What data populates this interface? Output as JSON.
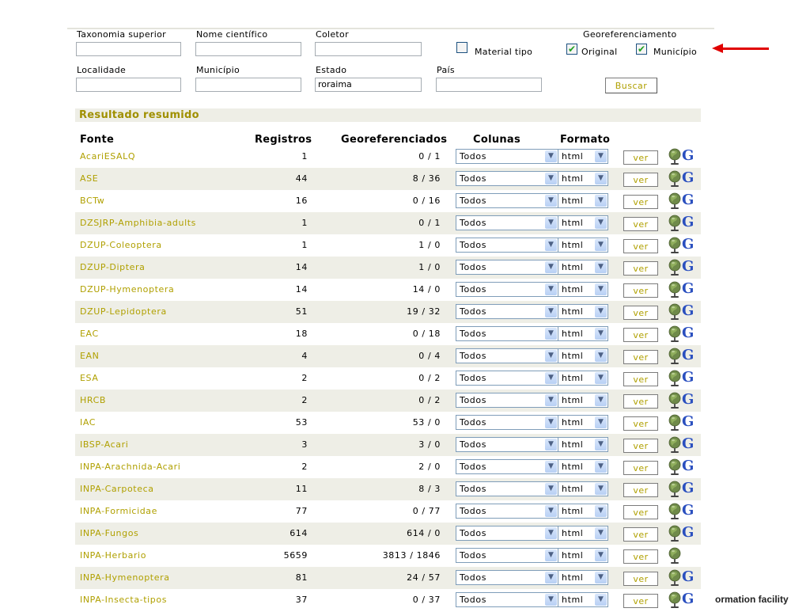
{
  "search_form": {
    "taxonomia_label": "Taxonomia superior",
    "nome_label": "Nome científico",
    "coletor_label": "Coletor",
    "material_tipo_label": "Material tipo",
    "georef_label": "Georeferenciamento",
    "original_label": "Original",
    "municipio_cb_label": "Município",
    "localidade_label": "Localidade",
    "municipio_label": "Município",
    "estado_label": "Estado",
    "estado_value": "roraima",
    "pais_label": "País",
    "buscar_label": "Buscar",
    "material_tipo_checked": false,
    "original_checked": true,
    "municipio_checked": true
  },
  "results": {
    "title": "Resultado resumido",
    "headers": {
      "fonte": "Fonte",
      "registros": "Registros",
      "georef": "Georeferenciados",
      "colunas": "Colunas",
      "formato": "Formato"
    },
    "ver_label": "ver",
    "g_label": "G",
    "rows": [
      {
        "fonte": "AcariESALQ",
        "registros": "1",
        "georef": "0 / 1",
        "colunas": "Todos",
        "formato": "html",
        "g": true
      },
      {
        "fonte": "ASE",
        "registros": "44",
        "georef": "8 / 36",
        "colunas": "Todos",
        "formato": "html",
        "g": true
      },
      {
        "fonte": "BCTw",
        "registros": "16",
        "georef": "0 / 16",
        "colunas": "Todos",
        "formato": "html",
        "g": true
      },
      {
        "fonte": "DZSJRP-Amphibia-adults",
        "registros": "1",
        "georef": "0 / 1",
        "colunas": "Todos",
        "formato": "html",
        "g": true
      },
      {
        "fonte": "DZUP-Coleoptera",
        "registros": "1",
        "georef": "1 / 0",
        "colunas": "Todos",
        "formato": "html",
        "g": true
      },
      {
        "fonte": "DZUP-Diptera",
        "registros": "14",
        "georef": "1 / 0",
        "colunas": "Todos",
        "formato": "html",
        "g": true
      },
      {
        "fonte": "DZUP-Hymenoptera",
        "registros": "14",
        "georef": "14 / 0",
        "colunas": "Todos",
        "formato": "html",
        "g": true
      },
      {
        "fonte": "DZUP-Lepidoptera",
        "registros": "51",
        "georef": "19 / 32",
        "colunas": "Todos",
        "formato": "html",
        "g": true
      },
      {
        "fonte": "EAC",
        "registros": "18",
        "georef": "0 / 18",
        "colunas": "Todos",
        "formato": "html",
        "g": true
      },
      {
        "fonte": "EAN",
        "registros": "4",
        "georef": "0 / 4",
        "colunas": "Todos",
        "formato": "html",
        "g": true
      },
      {
        "fonte": "ESA",
        "registros": "2",
        "georef": "0 / 2",
        "colunas": "Todos",
        "formato": "html",
        "g": true
      },
      {
        "fonte": "HRCB",
        "registros": "2",
        "georef": "0 / 2",
        "colunas": "Todos",
        "formato": "html",
        "g": true
      },
      {
        "fonte": "IAC",
        "registros": "53",
        "georef": "53 / 0",
        "colunas": "Todos",
        "formato": "html",
        "g": true
      },
      {
        "fonte": "IBSP-Acari",
        "registros": "3",
        "georef": "3 / 0",
        "colunas": "Todos",
        "formato": "html",
        "g": true
      },
      {
        "fonte": "INPA-Arachnida-Acari",
        "registros": "2",
        "georef": "2 / 0",
        "colunas": "Todos",
        "formato": "html",
        "g": true
      },
      {
        "fonte": "INPA-Carpoteca",
        "registros": "11",
        "georef": "8 / 3",
        "colunas": "Todos",
        "formato": "html",
        "g": true
      },
      {
        "fonte": "INPA-Formicidae",
        "registros": "77",
        "georef": "0 / 77",
        "colunas": "Todos",
        "formato": "html",
        "g": true
      },
      {
        "fonte": "INPA-Fungos",
        "registros": "614",
        "georef": "614 / 0",
        "colunas": "Todos",
        "formato": "html",
        "g": true
      },
      {
        "fonte": "INPA-Herbario",
        "registros": "5659",
        "georef": "3813 / 1846",
        "colunas": "Todos",
        "formato": "html",
        "g": false
      },
      {
        "fonte": "INPA-Hymenoptera",
        "registros": "81",
        "georef": "24 / 57",
        "colunas": "Todos",
        "formato": "html",
        "g": true
      },
      {
        "fonte": "INPA-Insecta-tipos",
        "registros": "37",
        "georef": "0 / 37",
        "colunas": "Todos",
        "formato": "html",
        "g": true
      }
    ]
  },
  "footer": {
    "text": "ormation facility"
  },
  "colors": {
    "link": "#b0a000",
    "title": "#a09000",
    "stripe": "#eeeee6",
    "annotation_arrow": "#e00000"
  },
  "icons": {
    "globe": "globe-icon",
    "google_earth": "g-icon",
    "dropdown": "chevron-down-icon",
    "arrow": "red-arrow-icon"
  }
}
